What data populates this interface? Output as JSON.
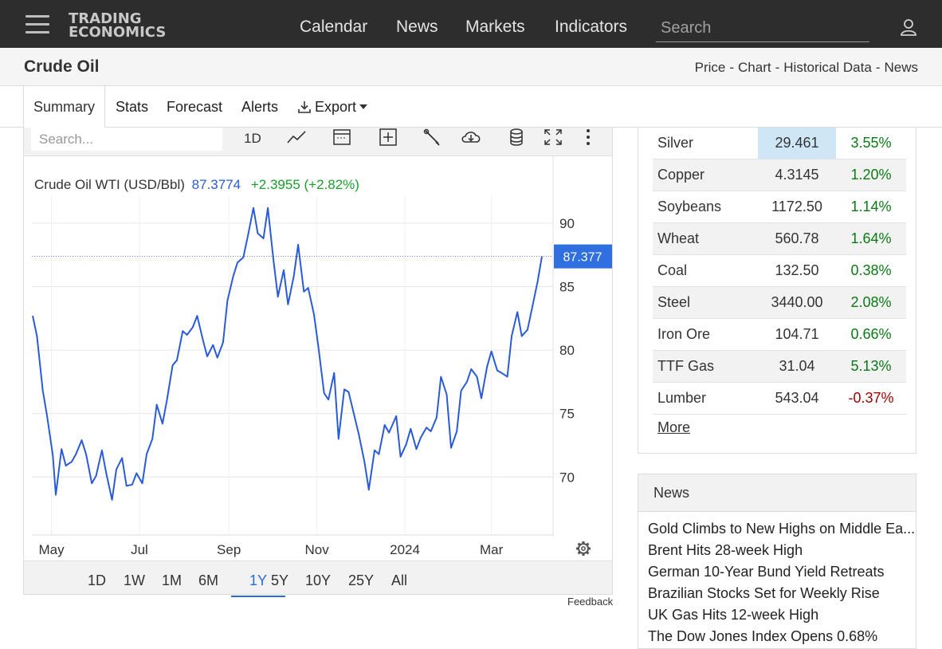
{
  "header": {
    "logo_line1": "TRADING",
    "logo_line2": "ECONOMICS",
    "nav": [
      "Calendar",
      "News",
      "Markets",
      "Indicators"
    ],
    "search_placeholder": "Search",
    "icons": {
      "menu": "hamburger-icon",
      "user": "user-icon"
    }
  },
  "subheader": {
    "title": "Crude Oil",
    "links": [
      "Price",
      "Chart",
      "Historical Data",
      "News"
    ],
    "separator": "-"
  },
  "tabs": [
    "Summary",
    "Stats",
    "Forecast",
    "Alerts",
    "Export"
  ],
  "chart_toolbar": {
    "search_placeholder": "Search...",
    "interval": "1D",
    "icons": [
      "line-type-icon",
      "calendar-icon",
      "add-icon",
      "wrench-icon",
      "download-cloud-icon",
      "database-icon",
      "fullscreen-icon",
      "more-vert-icon"
    ]
  },
  "chart_legend": {
    "name": "Crude Oil WTI (USD/Bbl)",
    "price": "87.3774",
    "change": "+2.3955 (+2.82%)"
  },
  "last_price_label": "87.377",
  "ranges": [
    "1D",
    "1W",
    "1M",
    "6M",
    "1Y",
    "5Y",
    "10Y",
    "25Y",
    "All"
  ],
  "active_range": "1Y",
  "feedback": "Feedback",
  "chart_data": {
    "type": "line",
    "title": "",
    "xlabel": "",
    "ylabel": "",
    "x_tick_labels": [
      "May",
      "Jul",
      "Sep",
      "Nov",
      "2024",
      "Mar"
    ],
    "y_tick_labels": [
      "90",
      "85",
      "80",
      "75",
      "70"
    ],
    "ylim": [
      66.5,
      91.5
    ],
    "grid": true,
    "series": [
      {
        "name": "Crude Oil WTI (USD/Bbl)",
        "color": "#2a5bd7",
        "x": [
          "2023-04-18",
          "2023-04-21",
          "2023-04-25",
          "2023-04-28",
          "2023-05-02",
          "2023-05-04",
          "2023-05-08",
          "2023-05-11",
          "2023-05-15",
          "2023-05-18",
          "2023-05-22",
          "2023-05-25",
          "2023-05-29",
          "2023-06-01",
          "2023-06-05",
          "2023-06-08",
          "2023-06-12",
          "2023-06-15",
          "2023-06-19",
          "2023-06-22",
          "2023-06-26",
          "2023-06-29",
          "2023-07-03",
          "2023-07-06",
          "2023-07-10",
          "2023-07-13",
          "2023-07-17",
          "2023-07-20",
          "2023-07-24",
          "2023-07-27",
          "2023-07-31",
          "2023-08-03",
          "2023-08-07",
          "2023-08-10",
          "2023-08-14",
          "2023-08-17",
          "2023-08-21",
          "2023-08-24",
          "2023-08-28",
          "2023-08-31",
          "2023-09-04",
          "2023-09-07",
          "2023-09-11",
          "2023-09-14",
          "2023-09-18",
          "2023-09-21",
          "2023-09-25",
          "2023-09-28",
          "2023-10-02",
          "2023-10-05",
          "2023-10-09",
          "2023-10-12",
          "2023-10-16",
          "2023-10-19",
          "2023-10-23",
          "2023-10-26",
          "2023-10-30",
          "2023-11-02",
          "2023-11-06",
          "2023-11-09",
          "2023-11-13",
          "2023-11-16",
          "2023-11-20",
          "2023-11-23",
          "2023-11-27",
          "2023-11-30",
          "2023-12-04",
          "2023-12-07",
          "2023-12-11",
          "2023-12-14",
          "2023-12-18",
          "2023-12-21",
          "2023-12-26",
          "2023-12-29",
          "2024-01-02",
          "2024-01-05",
          "2024-01-09",
          "2024-01-12",
          "2024-01-16",
          "2024-01-19",
          "2024-01-23",
          "2024-01-26",
          "2024-01-30",
          "2024-02-02",
          "2024-02-06",
          "2024-02-09",
          "2024-02-13",
          "2024-02-16",
          "2024-02-20",
          "2024-02-23",
          "2024-02-27",
          "2024-03-01",
          "2024-03-05",
          "2024-03-08",
          "2024-03-12",
          "2024-03-15",
          "2024-03-19",
          "2024-03-22",
          "2024-03-26",
          "2024-03-29",
          "2024-04-02",
          "2024-04-05"
        ],
        "values": [
          82.7,
          81.1,
          76.8,
          74.8,
          71.7,
          68.6,
          72.2,
          70.9,
          71.2,
          71.8,
          72.9,
          71.8,
          69.5,
          70.1,
          72.1,
          70.3,
          68.2,
          70.6,
          71.5,
          69.3,
          69.4,
          70.3,
          69.5,
          71.8,
          73.0,
          75.7,
          74.2,
          76.0,
          78.8,
          79.2,
          81.5,
          81.2,
          81.8,
          82.7,
          80.8,
          79.5,
          80.4,
          79.4,
          80.6,
          83.9,
          85.8,
          86.9,
          87.3,
          88.9,
          91.2,
          89.2,
          88.8,
          91.2,
          87.0,
          84.2,
          86.3,
          83.6,
          85.8,
          88.3,
          84.6,
          84.9,
          82.8,
          80.3,
          76.6,
          76.1,
          78.2,
          73.0,
          76.9,
          76.7,
          74.8,
          73.4,
          71.2,
          69.0,
          72.1,
          71.8,
          74.1,
          73.5,
          74.8,
          71.6,
          72.6,
          73.8,
          72.2,
          73.1,
          73.9,
          73.6,
          74.7,
          77.9,
          76.5,
          72.3,
          73.6,
          76.8,
          77.5,
          78.5,
          77.9,
          76.2,
          78.7,
          79.9,
          78.4,
          78.2,
          77.9,
          81.1,
          83.0,
          81.1,
          81.6,
          83.2,
          85.4,
          87.38
        ]
      }
    ]
  },
  "commodities": {
    "rows": [
      {
        "name": "Silver",
        "price": "29.461",
        "change": "3.55%",
        "positive": true,
        "highlight": true
      },
      {
        "name": "Copper",
        "price": "4.3145",
        "change": "1.20%",
        "positive": true
      },
      {
        "name": "Soybeans",
        "price": "1172.50",
        "change": "1.14%",
        "positive": true
      },
      {
        "name": "Wheat",
        "price": "560.78",
        "change": "1.64%",
        "positive": true
      },
      {
        "name": "Coal",
        "price": "132.50",
        "change": "0.38%",
        "positive": true
      },
      {
        "name": "Steel",
        "price": "3440.00",
        "change": "2.08%",
        "positive": true
      },
      {
        "name": "Iron Ore",
        "price": "104.71",
        "change": "0.66%",
        "positive": true
      },
      {
        "name": "TTF Gas",
        "price": "31.04",
        "change": "5.13%",
        "positive": true
      },
      {
        "name": "Lumber",
        "price": "543.04",
        "change": "-0.37%",
        "positive": false
      }
    ],
    "more_label": "More"
  },
  "news": {
    "title": "News",
    "items": [
      "Gold Climbs to New Highs on Middle Ea...",
      "Brent Hits 28-week High",
      "German 10-Year Bund Yield Retreats",
      "Brazilian Stocks Set for Weekly Rise",
      "UK Gas Hits 12-week High",
      "The Dow Jones Index Opens 0.68%"
    ]
  }
}
